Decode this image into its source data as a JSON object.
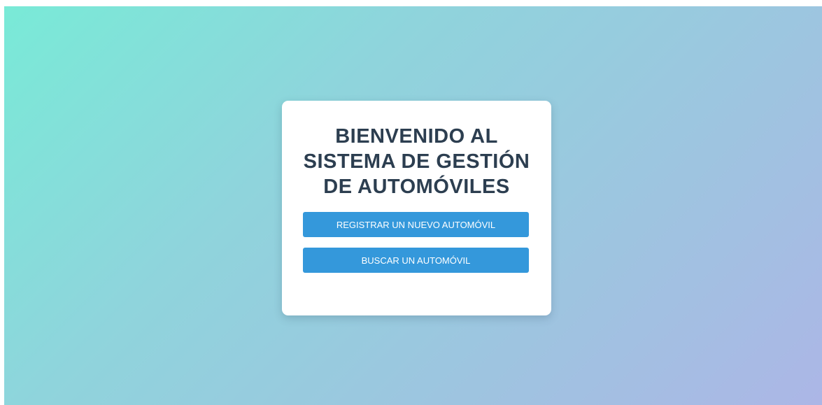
{
  "welcome": {
    "title": "BIENVENIDO AL SISTEMA DE GESTIÓN DE AUTOMÓVILES",
    "register_button": "REGISTRAR UN NUEVO AUTOMÓVIL",
    "search_button": "BUSCAR UN AUTOMÓVIL"
  },
  "colors": {
    "button": "#3498db",
    "title_text": "#2c3e50",
    "gradient_start": "#79ead7",
    "gradient_end": "#acb6e6"
  }
}
